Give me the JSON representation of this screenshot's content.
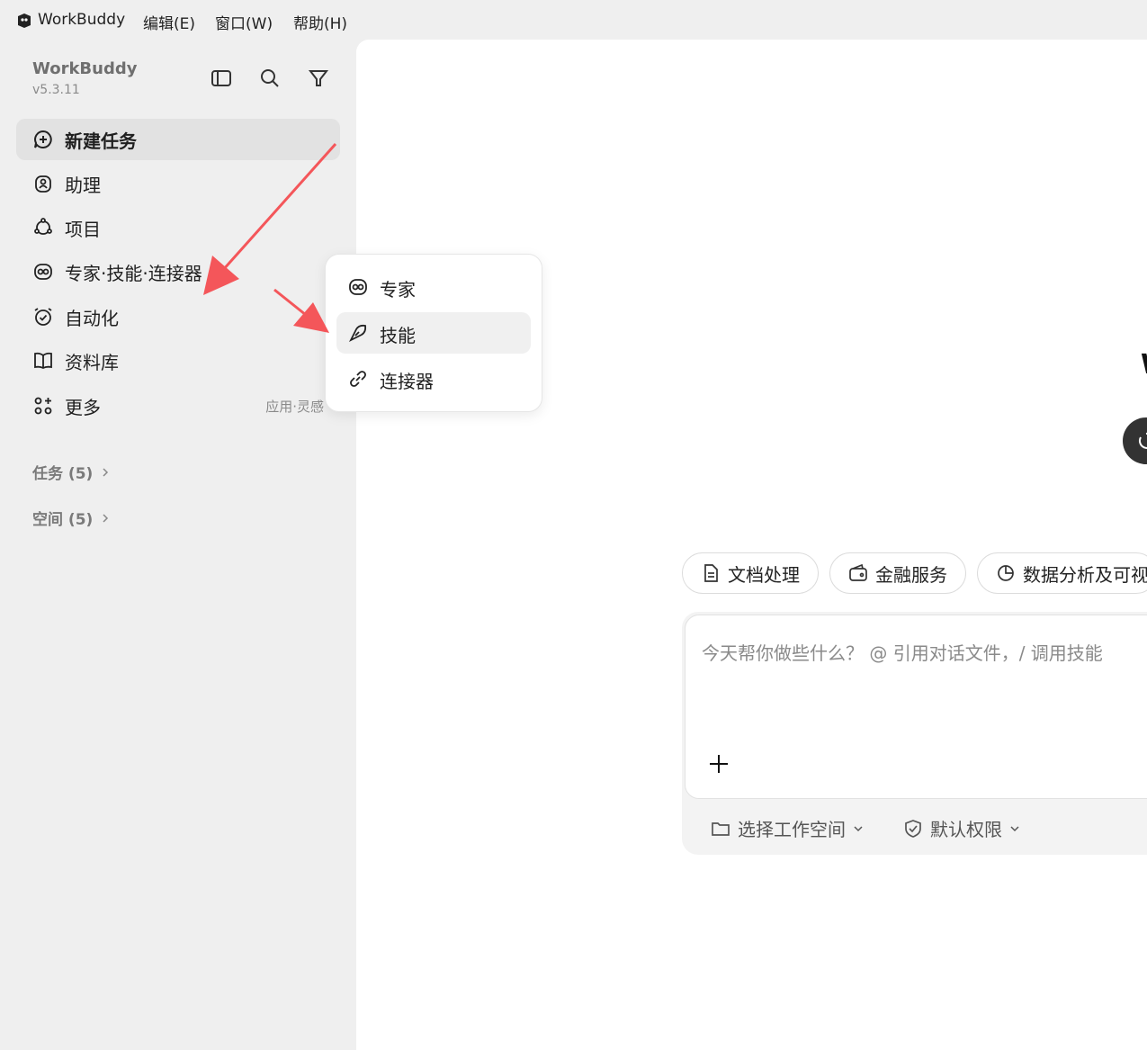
{
  "menubar": {
    "app_name": "WorkBuddy",
    "menus": [
      "编辑(E)",
      "窗口(W)",
      "帮助(H)"
    ]
  },
  "sidebar": {
    "brand": "WorkBuddy",
    "version": "v5.3.11",
    "icons": [
      "sidebar-toggle-icon",
      "search-icon",
      "filter-icon"
    ],
    "items": [
      {
        "label": "新建任务",
        "icon": "new-task-icon",
        "active": true
      },
      {
        "label": "助理",
        "icon": "assistant-icon"
      },
      {
        "label": "项目",
        "icon": "project-icon"
      },
      {
        "label": "专家·技能·连接器",
        "icon": "expert-icon"
      },
      {
        "label": "自动化",
        "icon": "alarm-clock-icon"
      },
      {
        "label": "资料库",
        "icon": "book-icon"
      },
      {
        "label": "更多",
        "icon": "grid-icon",
        "extra": "应用·灵感"
      }
    ],
    "groups": [
      {
        "label": "任务 (5)"
      },
      {
        "label": "空间 (5)"
      }
    ]
  },
  "popup": {
    "items": [
      {
        "label": "专家",
        "icon": "expert-icon"
      },
      {
        "label": "技能",
        "icon": "skill-icon",
        "hover": true
      },
      {
        "label": "连接器",
        "icon": "link-icon"
      }
    ]
  },
  "main": {
    "partial_title_glyph": "W",
    "chips": [
      {
        "label": "文档处理",
        "icon": "document-icon"
      },
      {
        "label": "金融服务",
        "icon": "wallet-icon"
      },
      {
        "label": "数据分析及可视",
        "icon": "pie-chart-icon"
      }
    ],
    "composer": {
      "placeholder": "今天帮你做些什么？ @ 引用对话文件，/ 调用技能",
      "workspace_label": "选择工作空间",
      "permission_label": "默认权限"
    }
  },
  "colors": {
    "annotation_arrow": "#f4565a",
    "sidebar_bg": "#efefef",
    "active_item_bg": "#e2e2e2"
  }
}
